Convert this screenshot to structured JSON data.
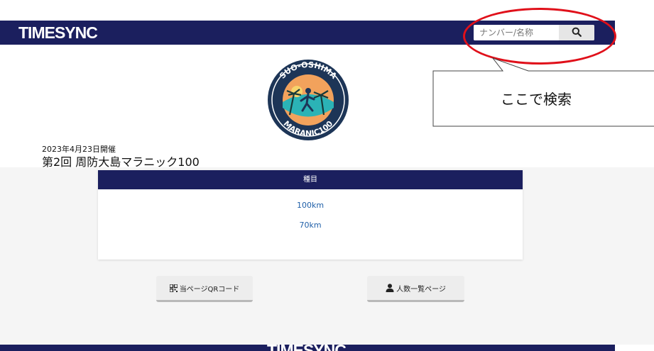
{
  "header": {
    "brand": "TIMESYNC",
    "search": {
      "placeholder": "ナンバー/名称",
      "button_icon": "search-icon"
    }
  },
  "callout": {
    "text": "ここで検索",
    "highlight_color": "#e0101a"
  },
  "event": {
    "date": "2023年4月23日開催",
    "title": "第2回 周防大島マラニック100",
    "logo_text": "SUO-OSHIMA MARANIC100"
  },
  "categories": {
    "header": "種目",
    "items": [
      {
        "label": "100km"
      },
      {
        "label": "70km"
      }
    ]
  },
  "buttons": {
    "qr": {
      "label": "当ページQRコード",
      "icon": "qr-code-icon"
    },
    "participants": {
      "label": "人数一覧ページ",
      "icon": "person-icon"
    }
  },
  "footer": {
    "brand": "TIMESYNC"
  },
  "colors": {
    "navy": "#1b1f5e",
    "link": "#1f5fa8",
    "content_bg": "#f5f5f5"
  }
}
